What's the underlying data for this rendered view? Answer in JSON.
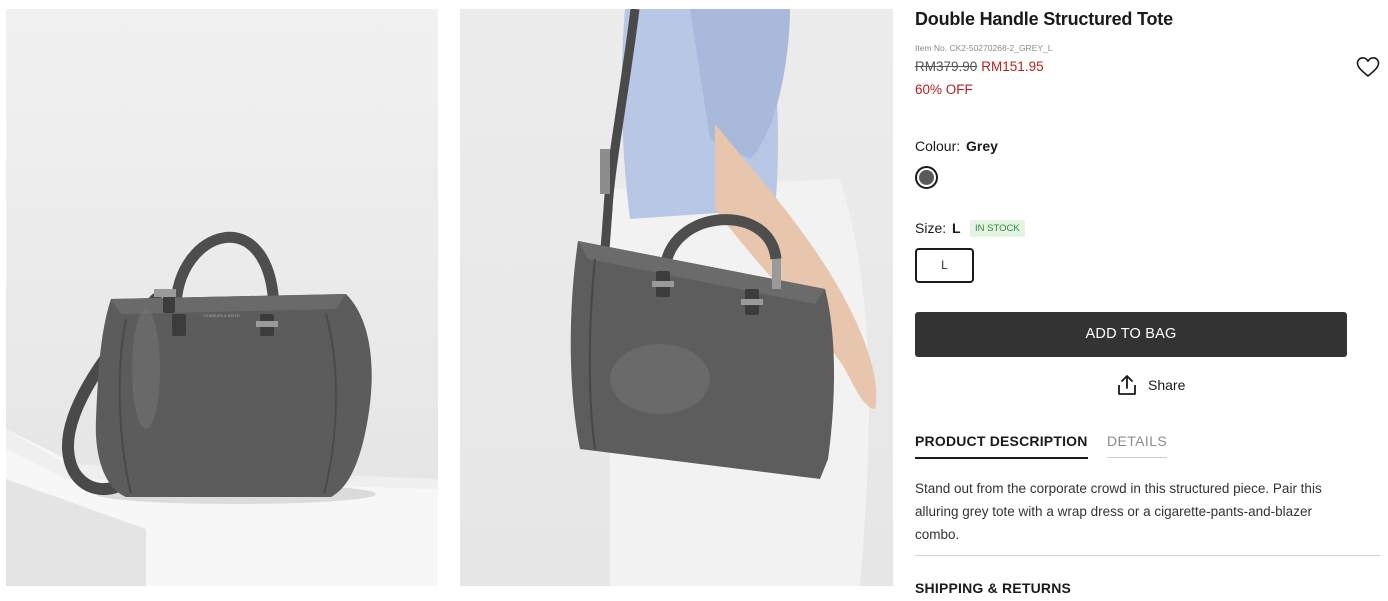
{
  "product": {
    "title": "Double Handle Structured Tote",
    "item_no": "Item No. CK2-50270268-2_GREY_L",
    "price_original": "RM379.90",
    "price_sale": "RM151.95",
    "discount": "60% OFF"
  },
  "colour": {
    "label": "Colour:",
    "value": "Grey",
    "swatch_color": "#595959"
  },
  "size": {
    "label": "Size:",
    "value": "L",
    "stock": "IN STOCK",
    "options": [
      "L"
    ]
  },
  "actions": {
    "add_to_bag": "ADD TO BAG",
    "share": "Share",
    "wishlist_icon": "heart-icon",
    "share_icon": "share-upload-icon"
  },
  "tabs": {
    "description": "PRODUCT DESCRIPTION",
    "details": "DETAILS"
  },
  "description": "Stand out from the corporate crowd in this structured piece. Pair this alluring grey tote with a wrap dress or a cigarette-pants-and-blazer combo.",
  "shipping": "SHIPPING & RETURNS",
  "colors": {
    "sale_red": "#b8201f",
    "button_dark": "#333333",
    "stock_green": "#2e8b3a",
    "stock_bg": "#e3f4e3",
    "bag_grey": "#595959"
  },
  "images": [
    "product-image-front",
    "product-image-model"
  ]
}
